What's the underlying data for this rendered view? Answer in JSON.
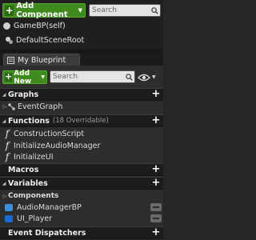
{
  "components": {
    "add_button": "Add Component",
    "search_placeholder": "Search",
    "tree": [
      {
        "label": "GameBP(self)"
      },
      {
        "label": "DefaultSceneRoot"
      }
    ]
  },
  "tab": {
    "label": "My Blueprint"
  },
  "toolbar": {
    "add_new": "Add New",
    "search_placeholder": "Search"
  },
  "sections": {
    "graphs": {
      "title": "Graphs",
      "items": [
        "EventGraph"
      ]
    },
    "functions": {
      "title": "Functions",
      "subtitle": "(18 Overridable)",
      "items": [
        "ConstructionScript",
        "InitializeAudioManager",
        "InitializeUI"
      ]
    },
    "macros": {
      "title": "Macros"
    },
    "variables": {
      "title": "Variables",
      "category": "Components",
      "items": [
        "AudioManagerBP",
        "UI_Player"
      ]
    },
    "dispatchers": {
      "title": "Event Dispatchers"
    }
  },
  "colors": {
    "accent_green": "#3f8a1f",
    "variable_blue": "#1c6ad0",
    "panel_bg": "#2d2d2d"
  }
}
